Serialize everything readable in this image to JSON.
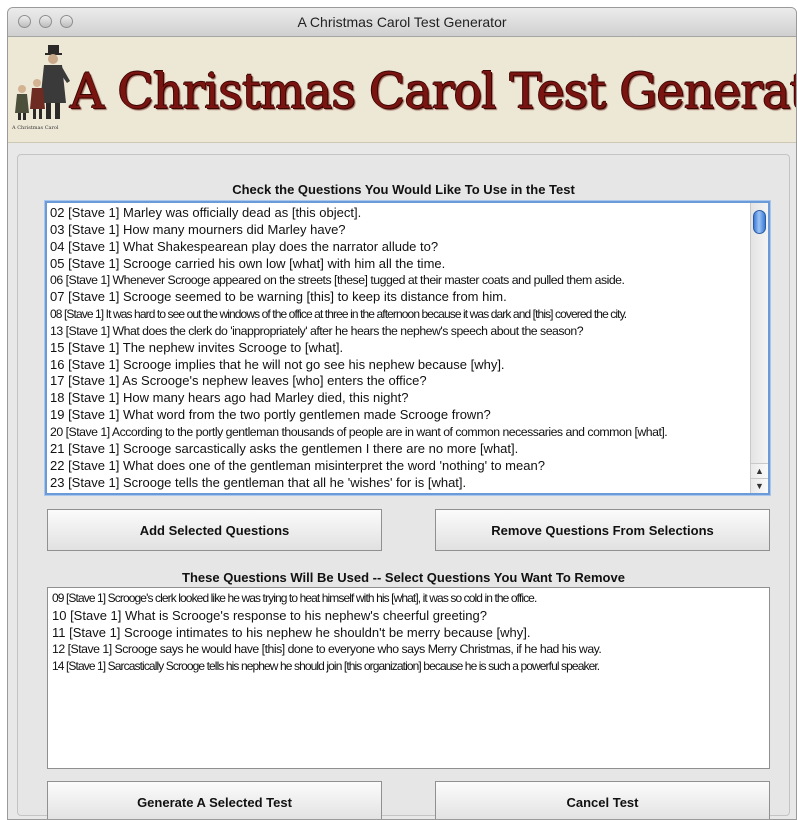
{
  "window": {
    "title": "A Christmas Carol Test Generator"
  },
  "banner": {
    "title": "A Christmas Carol Test Generator",
    "caption": "A Christmas Carol"
  },
  "available": {
    "heading": "Check the Questions You Would Like To Use in the Test",
    "items": [
      "02 [Stave 1]  Marley was officially dead as [this object].",
      "03 [Stave 1]  How many mourners did Marley have?",
      "04 [Stave 1]  What Shakespearean play does the narrator allude to?",
      "05 [Stave 1]  Scrooge carried his own low [what] with him all the time.",
      "06 [Stave 1] Whenever Scrooge appeared on the streets [these] tugged at their master coats and pulled them aside.",
      "07 [Stave 1]  Scrooge seemed to be warning [this] to keep its distance from him.",
      "08 [Stave 1] It was hard to see out the windows of the office at three in the afternoon because it was dark and [this] covered the city.",
      "13 [Stave 1] What does the clerk do 'inappropriately' after he hears the nephew's speech about the season?",
      "15 [Stave 1]  The nephew invites Scrooge to [what].",
      "16 [Stave 1]  Scrooge implies that he will not go see his nephew because [why].",
      "17 [Stave 1]  As Scrooge's nephew leaves [who] enters the office?",
      "18 [Stave 1]  How many hears ago had Marley died, this night?",
      "19 [Stave 1]  What word from the two portly gentlemen made Scrooge frown?",
      "20 [Stave 1] According to the portly gentleman thousands of people are in want of common necessaries and common [what].",
      "21 [Stave 1]  Scrooge sarcastically asks the gentlemen I there are no more [what].",
      "22 [Stave 1]  What does one of the gentleman misinterpret the word 'nothing' to mean?",
      "23 [Stave 1]  Scrooge tells the gentleman that all he 'wishes' for is [what]."
    ]
  },
  "buttons": {
    "add": "Add Selected Questions",
    "remove": "Remove Questions From Selections",
    "generate": "Generate A Selected Test",
    "cancel": "Cancel Test"
  },
  "selected": {
    "heading": "These Questions Will Be Used -- Select Questions You Want To Remove",
    "items": [
      "09 [Stave 1] Scrooge's clerk looked like he was trying to heat himself with his [what], it was so cold in the office.",
      "10 [Stave 1]  What is Scrooge's response to his nephew's cheerful greeting?",
      "11 [Stave 1]  Scrooge intimates to his nephew he shouldn't be merry because [why].",
      "12 [Stave 1] Scrooge says he would have [this] done to everyone who says Merry Christmas, if he had his way.",
      "14 [Stave 1] Sarcastically Scrooge tells his nephew he should join [this organization] because he is such a powerful speaker."
    ]
  },
  "colors": {
    "banner_title": "#7a1410",
    "banner_background": "#ede7d6",
    "focus_ring": "#6b9ad6",
    "scroll_thumb": "#3c7bd7"
  }
}
